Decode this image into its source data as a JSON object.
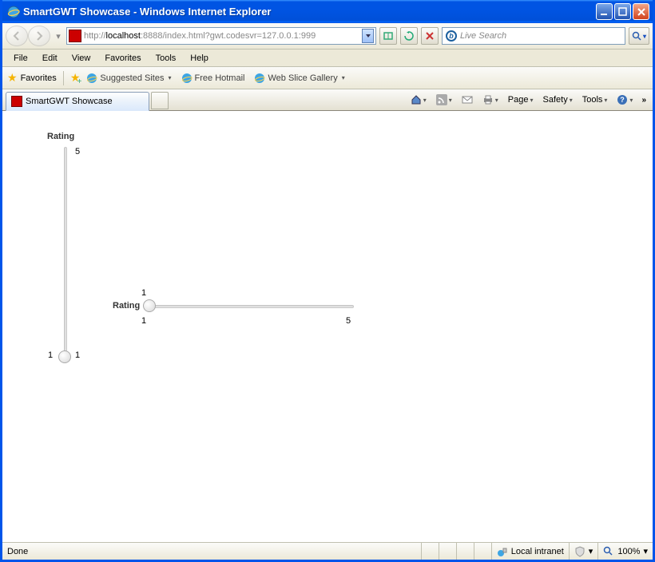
{
  "window": {
    "title": "SmartGWT Showcase - Windows Internet Explorer"
  },
  "navbar": {
    "url_prefix": "http://",
    "url_host": "localhost",
    "url_rest": ":8888/index.html?gwt.codesvr=127.0.0.1:999",
    "search_placeholder": "Live Search"
  },
  "menubar": {
    "items": [
      "File",
      "Edit",
      "View",
      "Favorites",
      "Tools",
      "Help"
    ]
  },
  "favbar": {
    "label": "Favorites",
    "links": [
      "Suggested Sites",
      "Free Hotmail",
      "Web Slice Gallery"
    ]
  },
  "tabs": {
    "active": "SmartGWT Showcase"
  },
  "commands": {
    "page": "Page",
    "safety": "Safety",
    "tools": "Tools"
  },
  "content": {
    "vslider": {
      "label": "Rating",
      "min": "1",
      "max": "5",
      "value": "1"
    },
    "hslider": {
      "label": "Rating",
      "min": "1",
      "max": "5",
      "value": "1"
    }
  },
  "statusbar": {
    "status": "Done",
    "zone": "Local intranet",
    "zoom": "100%"
  }
}
